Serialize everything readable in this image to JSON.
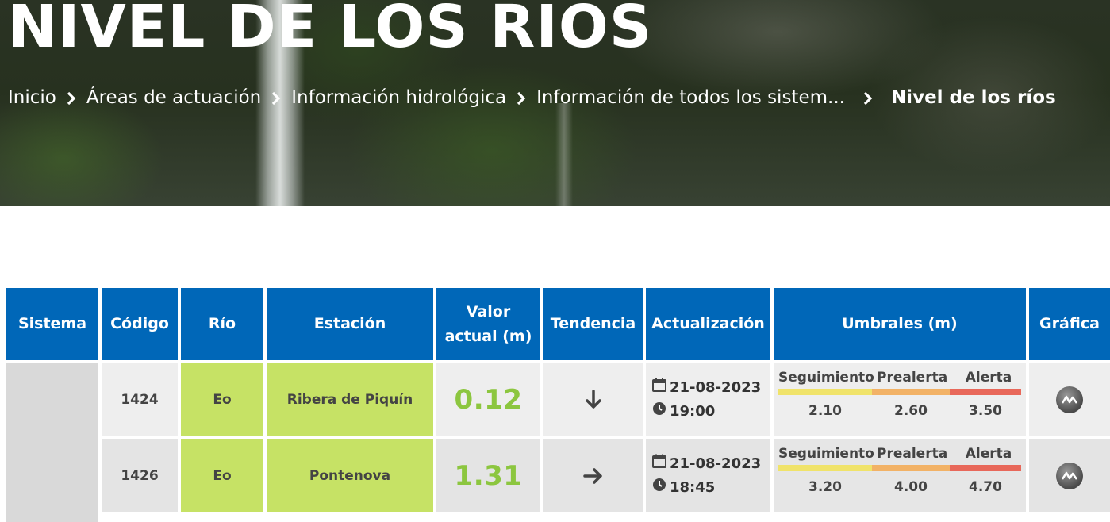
{
  "header": {
    "title": "NIVEL DE LOS RÍOS",
    "breadcrumb": [
      {
        "label": "Inicio"
      },
      {
        "label": "Áreas de actuación"
      },
      {
        "label": "Información hidrológica"
      },
      {
        "label": "Información de todos los sistem..."
      },
      {
        "label": "Nivel de los ríos"
      }
    ]
  },
  "table": {
    "headers": {
      "sistema": "Sistema",
      "codigo": "Código",
      "rio": "Río",
      "estacion": "Estación",
      "valor_line1": "Valor",
      "valor_line2": "actual (m)",
      "tendencia": "Tendencia",
      "actualizacion": "Actualización",
      "umbrales": "Umbrales (m)",
      "grafica": "Gráfica"
    },
    "threshold_labels": {
      "seguimiento": "Seguimiento",
      "prealerta": "Prealerta",
      "alerta": "Alerta"
    },
    "rows": [
      {
        "codigo": "1424",
        "rio": "Eo",
        "estacion": "Ribera de Piquín",
        "valor": "0.12",
        "tendencia": "down-arrow-icon",
        "fecha": "21-08-2023",
        "hora": "19:00",
        "seguimiento": "2.10",
        "prealerta": "2.60",
        "alerta": "3.50"
      },
      {
        "codigo": "1426",
        "rio": "Eo",
        "estacion": "Pontenova",
        "valor": "1.31",
        "tendencia": "right-arrow-icon",
        "fecha": "21-08-2023",
        "hora": "18:45",
        "seguimiento": "3.20",
        "prealerta": "4.00",
        "alerta": "4.70"
      }
    ]
  },
  "colors": {
    "header_blue": "#0067b8",
    "river_green": "#c6e265",
    "value_green": "#8cc63f",
    "seguimiento_yellow": "#f0e36a",
    "prealerta_orange": "#f2b266",
    "alerta_red": "#e8685a"
  }
}
